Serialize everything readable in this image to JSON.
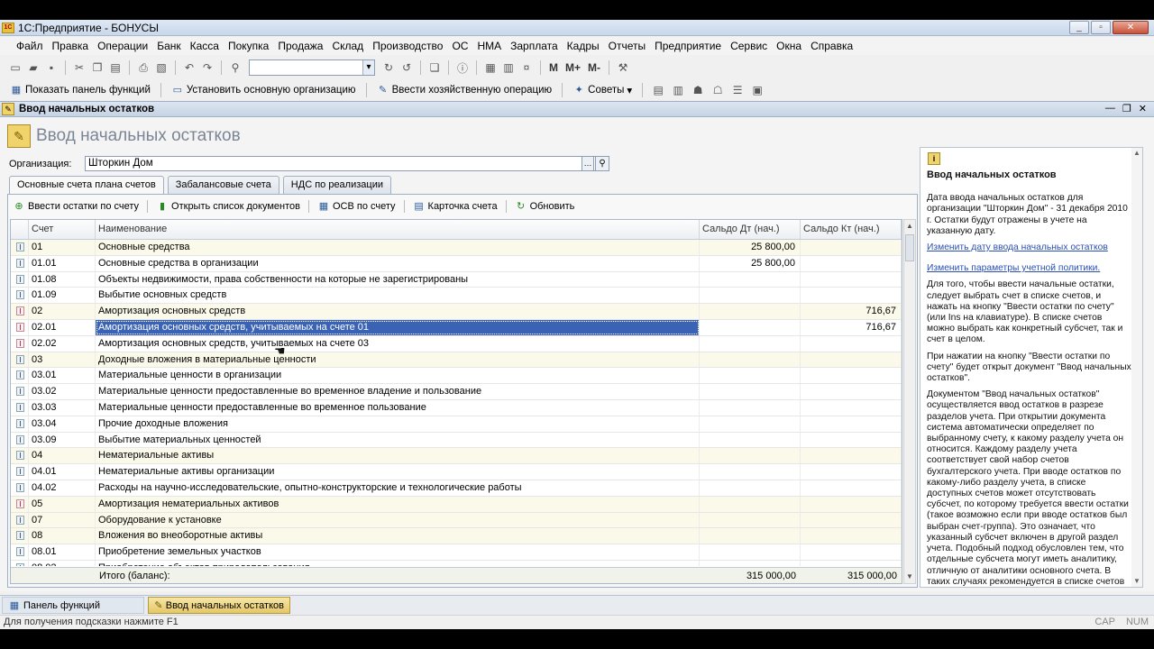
{
  "window": {
    "title": "1С:Предприятие - БОНУСЫ",
    "logo": "1С"
  },
  "menu": [
    "Файл",
    "Правка",
    "Операции",
    "Банк",
    "Касса",
    "Покупка",
    "Продажа",
    "Склад",
    "Производство",
    "ОС",
    "НМА",
    "Зарплата",
    "Кадры",
    "Отчеты",
    "Предприятие",
    "Сервис",
    "Окна",
    "Справка"
  ],
  "toolbar1": {
    "m": "М",
    "mplus": "М+",
    "mminus": "М-"
  },
  "toolbar2": {
    "functions_panel": "Показать панель функций",
    "set_org": "Установить основную организацию",
    "enter_op": "Ввести хозяйственную операцию",
    "tips": "Советы"
  },
  "form": {
    "window_title": "Ввод начальных остатков",
    "title": "Ввод начальных остатков",
    "org_label": "Организация:",
    "org_value": "Шторкин Дом",
    "tabs": [
      "Основные счета плана счетов",
      "Забалансовые счета",
      "НДС по реализации"
    ],
    "actions": [
      "Ввести остатки по счету",
      "Открыть список документов",
      "ОСВ по счету",
      "Карточка счета",
      "Обновить"
    ],
    "columns": [
      "Счет",
      "Наименование",
      "Сальдо Дт (нач.)",
      "Сальдо Кт (нач.)"
    ],
    "rows": [
      {
        "code": "01",
        "name": "Основные средства",
        "dt": "25 800,00",
        "kt": "",
        "red": false
      },
      {
        "code": "01.01",
        "name": "Основные средства в организации",
        "dt": "25 800,00",
        "kt": "",
        "red": false
      },
      {
        "code": "01.08",
        "name": "Объекты недвижимости, права собственности на которые не зарегистрированы",
        "dt": "",
        "kt": "",
        "red": false
      },
      {
        "code": "01.09",
        "name": "Выбытие основных средств",
        "dt": "",
        "kt": "",
        "red": false
      },
      {
        "code": "02",
        "name": "Амортизация основных средств",
        "dt": "",
        "kt": "716,67",
        "red": true
      },
      {
        "code": "02.01",
        "name": "Амортизация основных средств, учитываемых на счете 01",
        "dt": "",
        "kt": "716,67",
        "red": true
      },
      {
        "code": "02.02",
        "name": "Амортизация основных средств, учитываемых на счете 03",
        "dt": "",
        "kt": "",
        "red": true
      },
      {
        "code": "03",
        "name": "Доходные вложения в материальные ценности",
        "dt": "",
        "kt": "",
        "red": false
      },
      {
        "code": "03.01",
        "name": "Материальные ценности в организации",
        "dt": "",
        "kt": "",
        "red": false
      },
      {
        "code": "03.02",
        "name": "Материальные ценности предоставленные во временное владение и пользование",
        "dt": "",
        "kt": "",
        "red": false
      },
      {
        "code": "03.03",
        "name": "Материальные ценности предоставленные во временное пользование",
        "dt": "",
        "kt": "",
        "red": false
      },
      {
        "code": "03.04",
        "name": "Прочие доходные вложения",
        "dt": "",
        "kt": "",
        "red": false
      },
      {
        "code": "03.09",
        "name": "Выбытие материальных ценностей",
        "dt": "",
        "kt": "",
        "red": false
      },
      {
        "code": "04",
        "name": "Нематериальные активы",
        "dt": "",
        "kt": "",
        "red": false
      },
      {
        "code": "04.01",
        "name": "Нематериальные активы организации",
        "dt": "",
        "kt": "",
        "red": false
      },
      {
        "code": "04.02",
        "name": "Расходы на научно-исследовательские, опытно-конструкторские и технологические работы",
        "dt": "",
        "kt": "",
        "red": false
      },
      {
        "code": "05",
        "name": "Амортизация нематериальных активов",
        "dt": "",
        "kt": "",
        "red": true
      },
      {
        "code": "07",
        "name": "Оборудование к установке",
        "dt": "",
        "kt": "",
        "red": false
      },
      {
        "code": "08",
        "name": "Вложения во внеоборотные активы",
        "dt": "",
        "kt": "",
        "red": false
      },
      {
        "code": "08.01",
        "name": "Приобретение земельных участков",
        "dt": "",
        "kt": "",
        "red": false
      },
      {
        "code": "08.02",
        "name": "Приобретение объектов природопользования",
        "dt": "",
        "kt": "",
        "red": false
      }
    ],
    "selected_row": 5,
    "total_label": "Итого (баланс):",
    "total_dt": "315 000,00",
    "total_kt": "315 000,00"
  },
  "help": {
    "title": "Ввод начальных остатков",
    "p1": "Дата ввода начальных остатков для организации \"Шторкин Дом\" - 31 декабря 2010 г. Остатки будут отражены в учете на указанную дату.",
    "link1": "Изменить дату ввода начальных остатков",
    "link2": "Изменить параметры учетной политики.",
    "p2": "Для того, чтобы ввести начальные остатки, следует выбрать счет в списке счетов, и нажать на кнопку \"Ввести остатки по счету\" (или Ins на клавиатуре). В списке счетов можно выбрать как конкретный субсчет, так и счет в целом.",
    "p3": "При нажатии на кнопку \"Ввести остатки по счету\" будет открыт документ \"Ввод начальных остатков\".",
    "p4": "Документом \"Ввод начальных остатков\" осуществляется ввод остатков в разрезе разделов учета. При открытии документа система автоматически определяет по выбранному счету, к какому разделу учета он относится. Каждому разделу учета соответствует свой набор счетов бухгалтерского учета. При вводе остатков по какому-либо разделу учета, в списке доступных счетов может отсутствовать субсчет, по которому требуется ввести остатки (такое возможно если при вводе остатков был выбран счет-группа). Это означает, что указанный субсчет включен в другой раздел учета. Подобный подход обусловлен тем, что отдельные субсчета могут иметь аналитику, отличную от аналитики основного счета. В таких случаях рекомендуется в списке счетов выбрать конкретный субсчет и нажать кнопку \"Ввести"
  },
  "taskbar": [
    "Панель функций",
    "Ввод начальных остатков"
  ],
  "status": {
    "hint": "Для получения подсказки нажмите F1",
    "cap": "CAP",
    "num": "NUM"
  }
}
